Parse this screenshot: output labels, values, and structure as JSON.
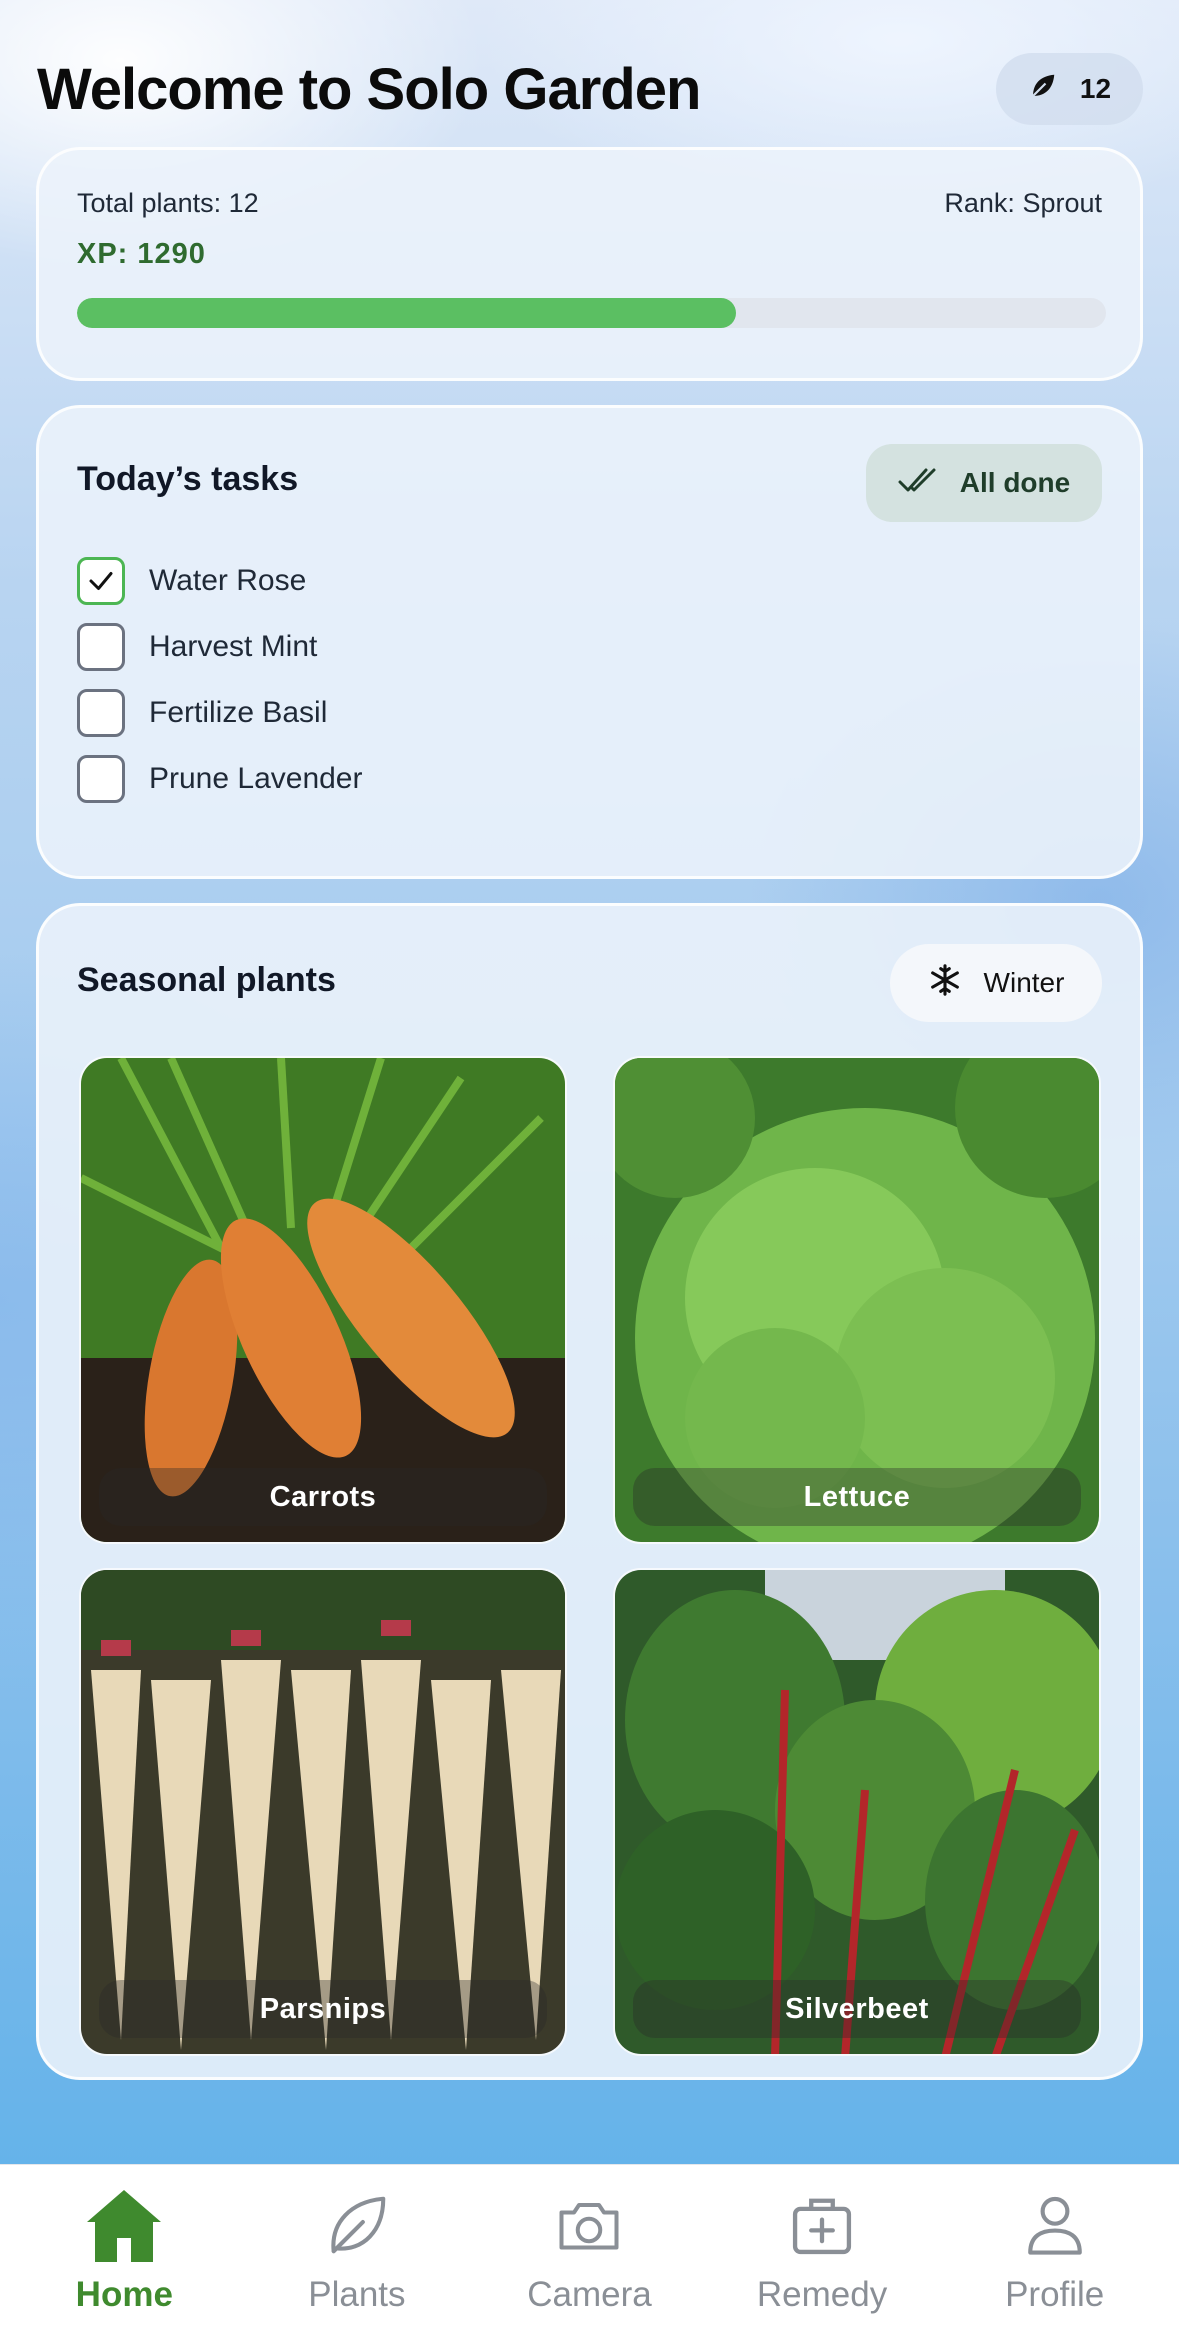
{
  "header": {
    "title": "Welcome to Solo Garden",
    "badge_icon": "leaf-icon",
    "badge_count": "12"
  },
  "stats": {
    "total_plants": "Total plants: 12",
    "rank": "Rank: Sprout",
    "xp": "XP: 1290",
    "xp_progress_fraction": 0.64,
    "progress_color": "#5bbf62"
  },
  "tasks": {
    "title": "Today’s tasks",
    "all_done_label": "All done",
    "all_done_icon": "double-check-icon",
    "items": [
      {
        "label": "Water Rose",
        "checked": true
      },
      {
        "label": "Harvest Mint",
        "checked": false
      },
      {
        "label": "Fertilize Basil",
        "checked": false
      },
      {
        "label": "Prune Lavender",
        "checked": false
      }
    ]
  },
  "seasonal": {
    "title": "Seasonal plants",
    "season_icon": "snowflake-icon",
    "season_label": "Winter",
    "plants": [
      {
        "name": "Carrots"
      },
      {
        "name": "Lettuce"
      },
      {
        "name": "Parsnips"
      },
      {
        "name": "Silverbeet"
      }
    ]
  },
  "tabs": [
    {
      "label": "Home",
      "icon": "home-icon",
      "active": true
    },
    {
      "label": "Plants",
      "icon": "leaf-icon",
      "active": false
    },
    {
      "label": "Camera",
      "icon": "camera-icon",
      "active": false
    },
    {
      "label": "Remedy",
      "icon": "medkit-icon",
      "active": false
    },
    {
      "label": "Profile",
      "icon": "person-icon",
      "active": false
    }
  ],
  "colors": {
    "accent_green": "#3f8a2e",
    "xp_text": "#2f6b2f",
    "inactive_tab": "#8a8f96"
  }
}
